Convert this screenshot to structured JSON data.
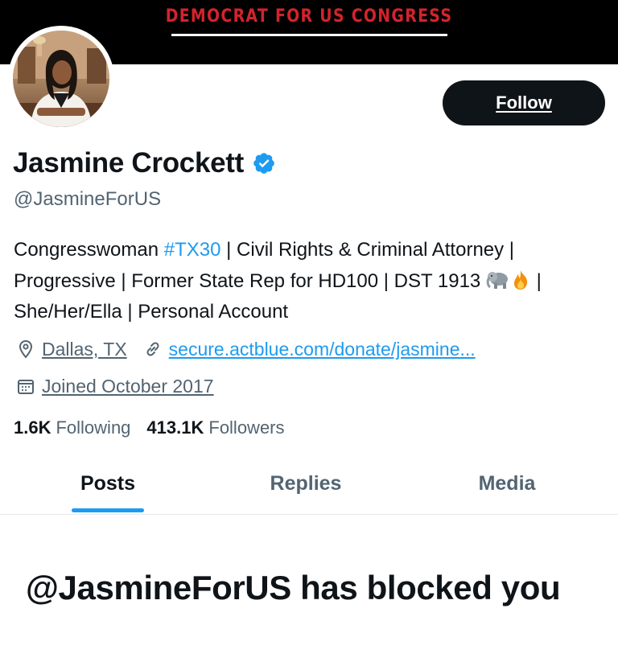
{
  "banner": {
    "text": "DEMOCRAT FOR US CONGRESS"
  },
  "profile": {
    "display_name": "Jasmine Crockett",
    "handle": "@JasmineForUS",
    "verified": true,
    "avatar_alt": "profile photo",
    "follow_label": "Follow"
  },
  "bio": {
    "part1": "Congresswoman ",
    "hashtag": "#TX30",
    "part2": " | Civil Rights & Criminal Attorney | Progressive | Former State Rep for HD100 | DST 1913 ",
    "part3": " | She/Her/Ella | Personal Account",
    "emoji_1": "elephant",
    "emoji_2": "fire"
  },
  "meta": {
    "location": "Dallas, TX",
    "location_icon": "location-pin-icon",
    "website": "secure.actblue.com/donate/jasmine...",
    "website_icon": "link-icon",
    "joined": "Joined October 2017",
    "joined_icon": "calendar-icon"
  },
  "stats": {
    "following_count": "1.6K",
    "following_label": "Following",
    "followers_count": "413.1K",
    "followers_label": "Followers"
  },
  "tabs": [
    {
      "label": "Posts",
      "active": true
    },
    {
      "label": "Replies",
      "active": false
    },
    {
      "label": "Media",
      "active": false
    }
  ],
  "blocked_message": "@JasmineForUS has blocked you",
  "colors": {
    "accent": "#1d9bf0",
    "banner_text": "#d3232b",
    "text_primary": "#0f1419",
    "text_secondary": "#536471"
  }
}
